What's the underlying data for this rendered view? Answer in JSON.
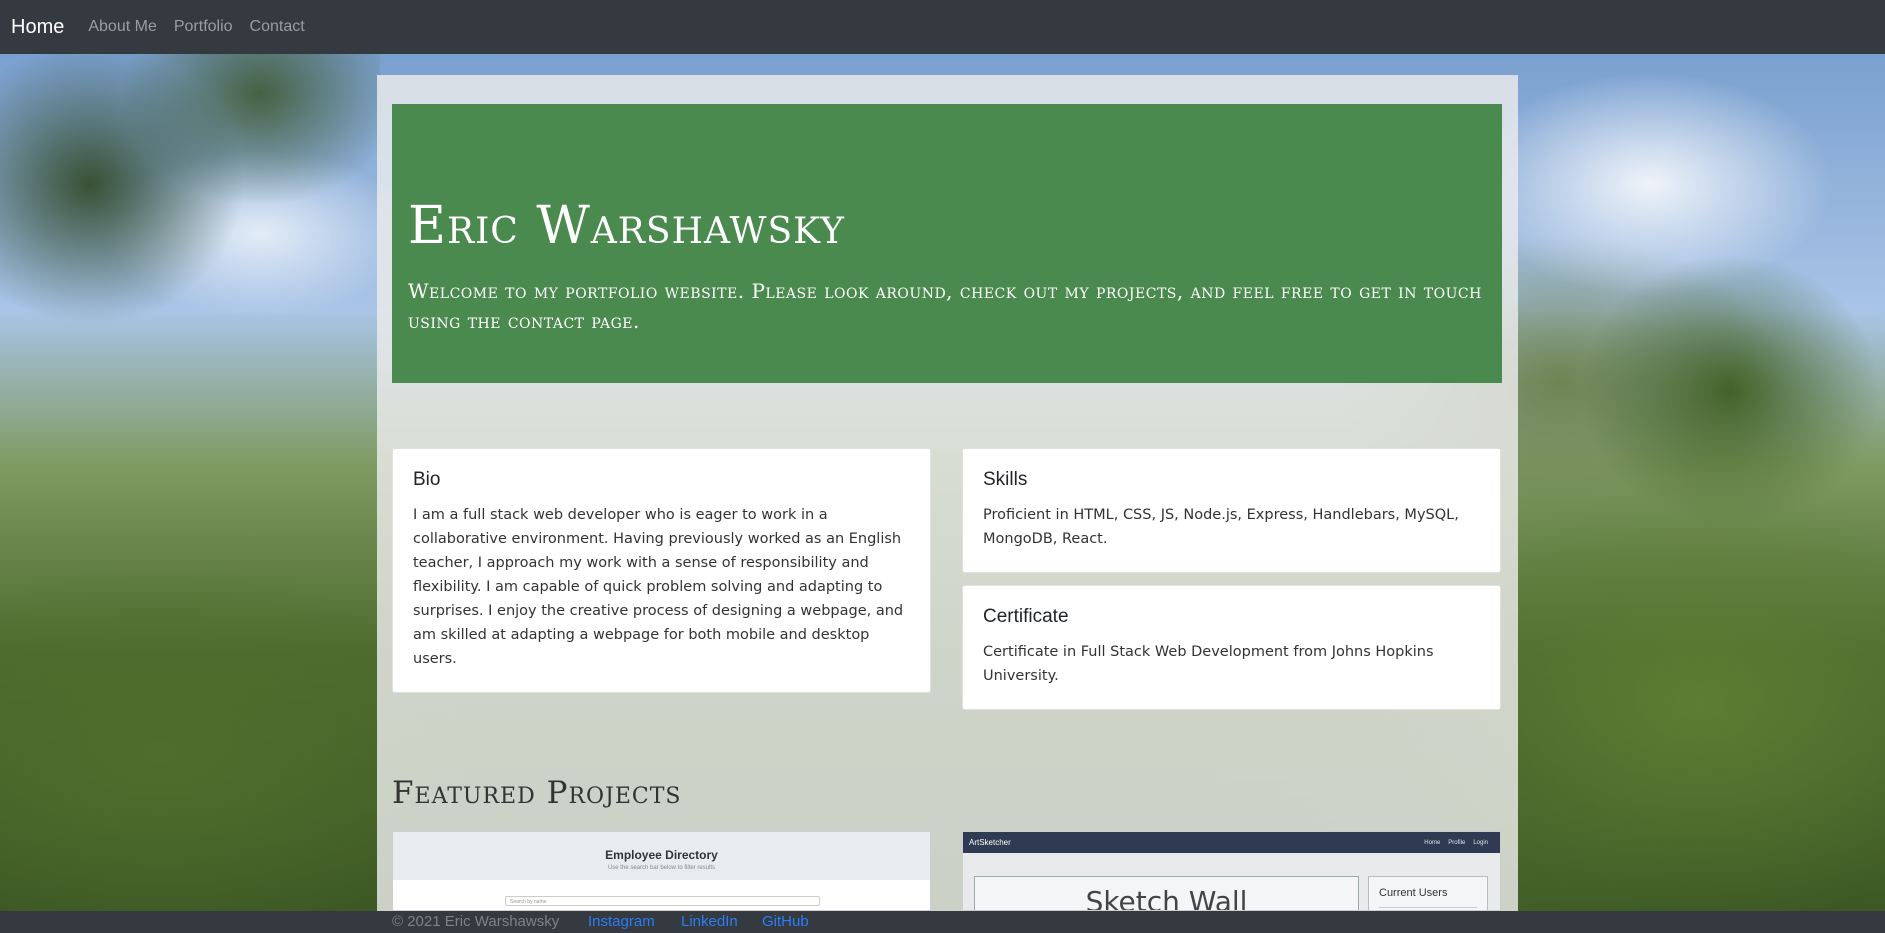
{
  "navbar": {
    "brand": "Home",
    "links": [
      "About Me",
      "Portfolio",
      "Contact"
    ]
  },
  "jumbotron": {
    "title": "Eric Warshawsky",
    "subtitle": "Welcome to my portfolio website. Please look around, check out my projects, and feel free to get in touch using the contact page."
  },
  "cards": {
    "bio": {
      "title": "Bio",
      "text": "I am a full stack web developer who is eager to work in a collaborative environment. Having previously worked as an English teacher, I approach my work with a sense of responsibility and flexibility. I am capable of quick problem solving and adapting to surprises. I enjoy the creative process of designing a webpage, and am skilled at adapting a webpage for both mobile and desktop users."
    },
    "skills": {
      "title": "Skills",
      "text": "Proficient in HTML, CSS, JS, Node.js, Express, Handlebars, MySQL, MongoDB, React."
    },
    "certificate": {
      "title": "Certificate",
      "text": "Certificate in Full Stack Web Development from Johns Hopkins University."
    }
  },
  "featured": {
    "heading": "Featured Projects",
    "project1": {
      "title": "Employee Directory",
      "subtitle": "Use the search bar below to filter results",
      "search_placeholder": "Search by name"
    },
    "project2": {
      "brand": "ArtSketcher",
      "nav": [
        "Home",
        "Profile",
        "Login"
      ],
      "wall_title": "Sketch Wall",
      "users_title": "Current Users"
    }
  },
  "footer": {
    "copyright": "© 2021 Eric Warshawsky",
    "links": [
      "Instagram",
      "LinkedIn",
      "GitHub"
    ]
  }
}
